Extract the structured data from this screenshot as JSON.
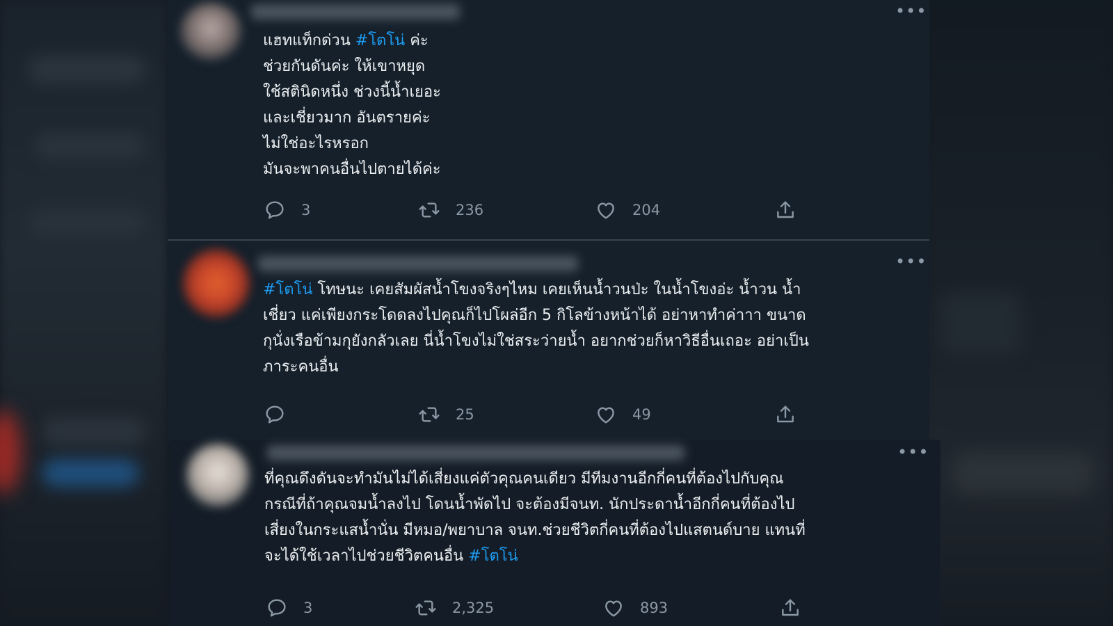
{
  "tweets": [
    {
      "text_before": "แฮทแท็กด่วน ",
      "hashtag": "#โตโน่",
      "text_after": " ค่ะ\nช่วยกันดันค่ะ  ให้เขาหยุด\nใช้สตินิดหนึ่ง ช่วงนี้น้ำเยอะ\nและเชี่ยวมาก อันตรายค่ะ\nไม่ใช่อะไรหรอก\nมันจะพาคนอื่นไปตายได้ค่ะ",
      "replies": "3",
      "retweets": "236",
      "likes": "204"
    },
    {
      "text_before": "",
      "hashtag": "#โตโน่",
      "text_after": " โทษนะ เคยสัมผัสน้ำโขงจริงๆไหม เคยเห็นน้ำวนป่ะ ในน้ำโขงอ่ะ น้ำวน น้ำ\nเชี่ยว แค่เพียงกระโดดลงไปคุณก็ไปโผล่อีก 5 กิโลข้างหน้าได้ อย่าหาทำค่าาา  ขนาด\nกุนั่งเรือข้ามกุยังกลัวเลย  นี่น้ำโขงไม่ใช่สระว่ายน้ำ อยากช่วยก็หาวิธีอื่นเถอะ อย่าเป็น\nภาระคนอื่น",
      "replies": "",
      "retweets": "25",
      "likes": "49"
    },
    {
      "text_before": "ที่คุณดึงดันจะทำมันไม่ได้เสี่ยงแค่ตัวคุณคนเดียว มีทีมงานอีกกี่คนที่ต้องไปกับคุณ\nกรณีที่ถ้าคุณจมน้ำลงไป โดนน้ำพัดไป จะต้องมีจนท. นักประดาน้ำอีกกี่คนที่ต้องไป\nเสี่ยงในกระแสน้ำนั่น มีหมอ/พยาบาล จนท.ช่วยชีวิตกี่คนที่ต้องไปแสตนด์บาย แทนที่\nจะได้ใช้เวลาไปช่วยชีวิตคนอื่น ",
      "hashtag": "#โตโน่",
      "text_after": "",
      "replies": "3",
      "retweets": "2,325",
      "likes": "893"
    }
  ],
  "more_label": "•••",
  "colors": {
    "background": "#15202b",
    "hashtag": "#1d9bf0",
    "muted": "#8b98a5",
    "text": "#eceff1"
  },
  "icons": [
    "reply-icon",
    "retweet-icon",
    "like-icon",
    "share-icon",
    "more-icon"
  ]
}
